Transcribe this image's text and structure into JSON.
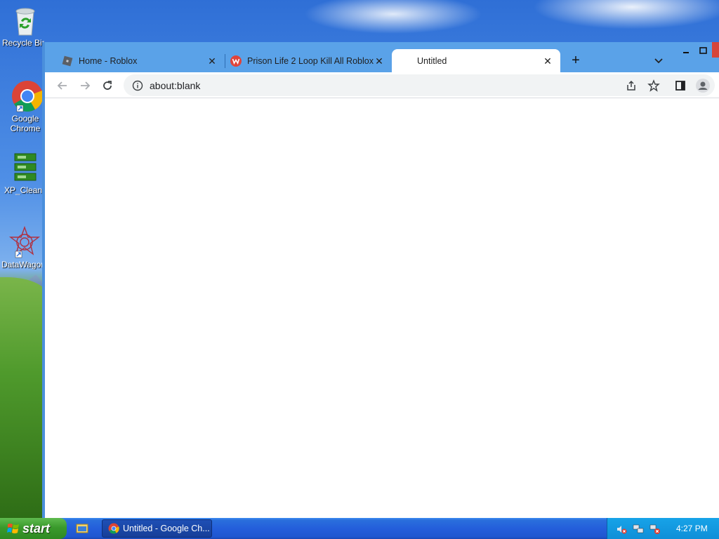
{
  "desktop": {
    "icons": [
      {
        "label": "Recycle Bin",
        "icon": "recycle-bin-icon"
      },
      {
        "label": "Google Chrome",
        "icon": "chrome-icon"
      },
      {
        "label": "XP_Clean",
        "icon": "xp-clean-icon"
      },
      {
        "label": "DataWagon",
        "icon": "datawagon-icon"
      }
    ]
  },
  "browser": {
    "tabs": [
      {
        "title": "Home - Roblox",
        "icon": "roblox-icon"
      },
      {
        "title": "Prison Life 2 Loop Kill All Roblox",
        "icon": "wearedevs-icon"
      },
      {
        "title": "Untitled",
        "icon": "blank-page-icon"
      }
    ],
    "address": {
      "url": "about:blank"
    },
    "accent": "#5aa2e8"
  },
  "taskbar": {
    "start_label": "start",
    "task_label": "Untitled - Google Ch...",
    "clock": "4:27 PM"
  }
}
